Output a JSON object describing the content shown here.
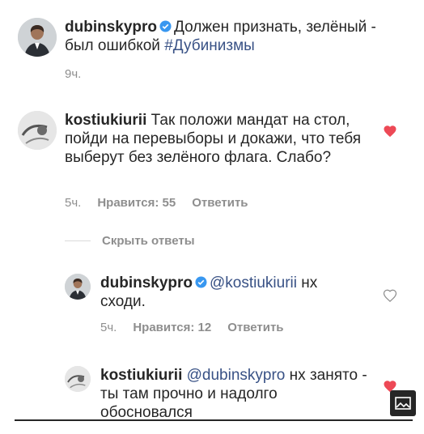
{
  "post": {
    "username": "dubinskypro",
    "text": "Должен признать, зелёный - был ошибкой",
    "hashtag": "#Дубинизмы",
    "time": "9ч."
  },
  "comment1": {
    "username": "kostiukiurii",
    "text": "Так положи мандат на стол,  пойди на перевыборы и докажи, что тебя выберут без зелёного флага. Слабо?",
    "time": "5ч.",
    "likes": "Нравится: 55",
    "reply": "Ответить",
    "liked": true
  },
  "hide_replies": "Скрыть ответы",
  "reply1": {
    "username": "dubinskypro",
    "mention": "@kostiukiurii",
    "text": "нх сходи.",
    "time": "5ч.",
    "likes": "Нравится: 12",
    "reply": "Ответить",
    "liked": false
  },
  "reply2": {
    "username": "kostiukiurii",
    "mention": "@dubinskypro",
    "text": "нх занято - ты там прочно и надолго обосновался",
    "liked": true
  },
  "icons": {
    "verified": "verified-badge-icon",
    "heart_filled": "heart-filled-icon",
    "heart_outline": "heart-outline-icon",
    "image": "image-icon"
  },
  "colors": {
    "accent": "#385185",
    "verified": "#3897f0",
    "like": "#ed4956",
    "muted": "#8e8e8e"
  }
}
